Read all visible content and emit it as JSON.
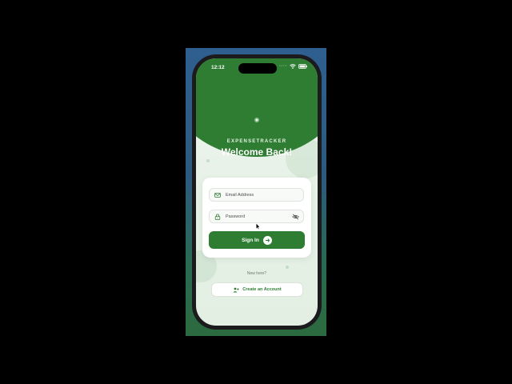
{
  "status_bar": {
    "time": "12:12"
  },
  "header": {
    "app_name": "EXPENSETRACKER",
    "title": "Welcome Back!"
  },
  "login_form": {
    "email_placeholder": "Email Address",
    "password_placeholder": "Password",
    "sign_in_label": "Sign In"
  },
  "signup": {
    "prompt": "New here?",
    "create_label": "Create an Account"
  },
  "colors": {
    "primary": "#2e7d32",
    "background": "#eef6ee"
  },
  "icons": [
    "mail-icon",
    "lock-icon",
    "eye-off-icon",
    "arrow-right-icon",
    "add-user-icon",
    "wifi-icon",
    "battery-icon"
  ]
}
